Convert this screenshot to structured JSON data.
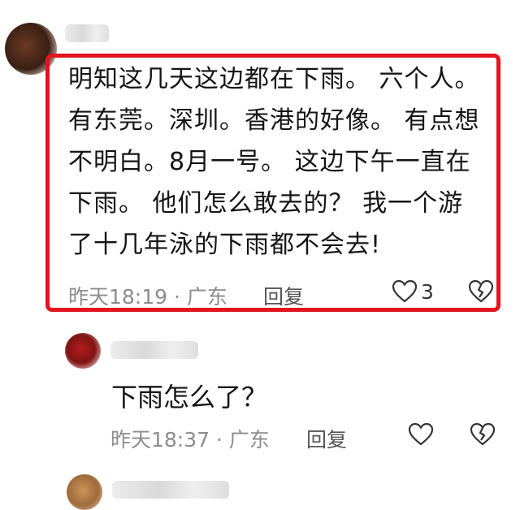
{
  "comments": [
    {
      "username": "",
      "lines": [
        "明知这几天这边都在下雨。 六个人。",
        "有东莞。深圳。香港的好像。 有点想",
        "不明白。8月一号。 这边下午一直在",
        "下雨。 他们怎么敢去的？   我一个游",
        "了十几年泳的下雨都不会去!"
      ],
      "time": "昨天18:19 · 广东",
      "reply_label": "回复",
      "like_count": "3",
      "highlight_color": "#e2141f"
    },
    {
      "username": "",
      "text": "下雨怎么了？",
      "time": "昨天18:37 · 广东",
      "reply_label": "回复"
    }
  ],
  "icons": [
    "heart-icon",
    "broken-heart-icon"
  ]
}
